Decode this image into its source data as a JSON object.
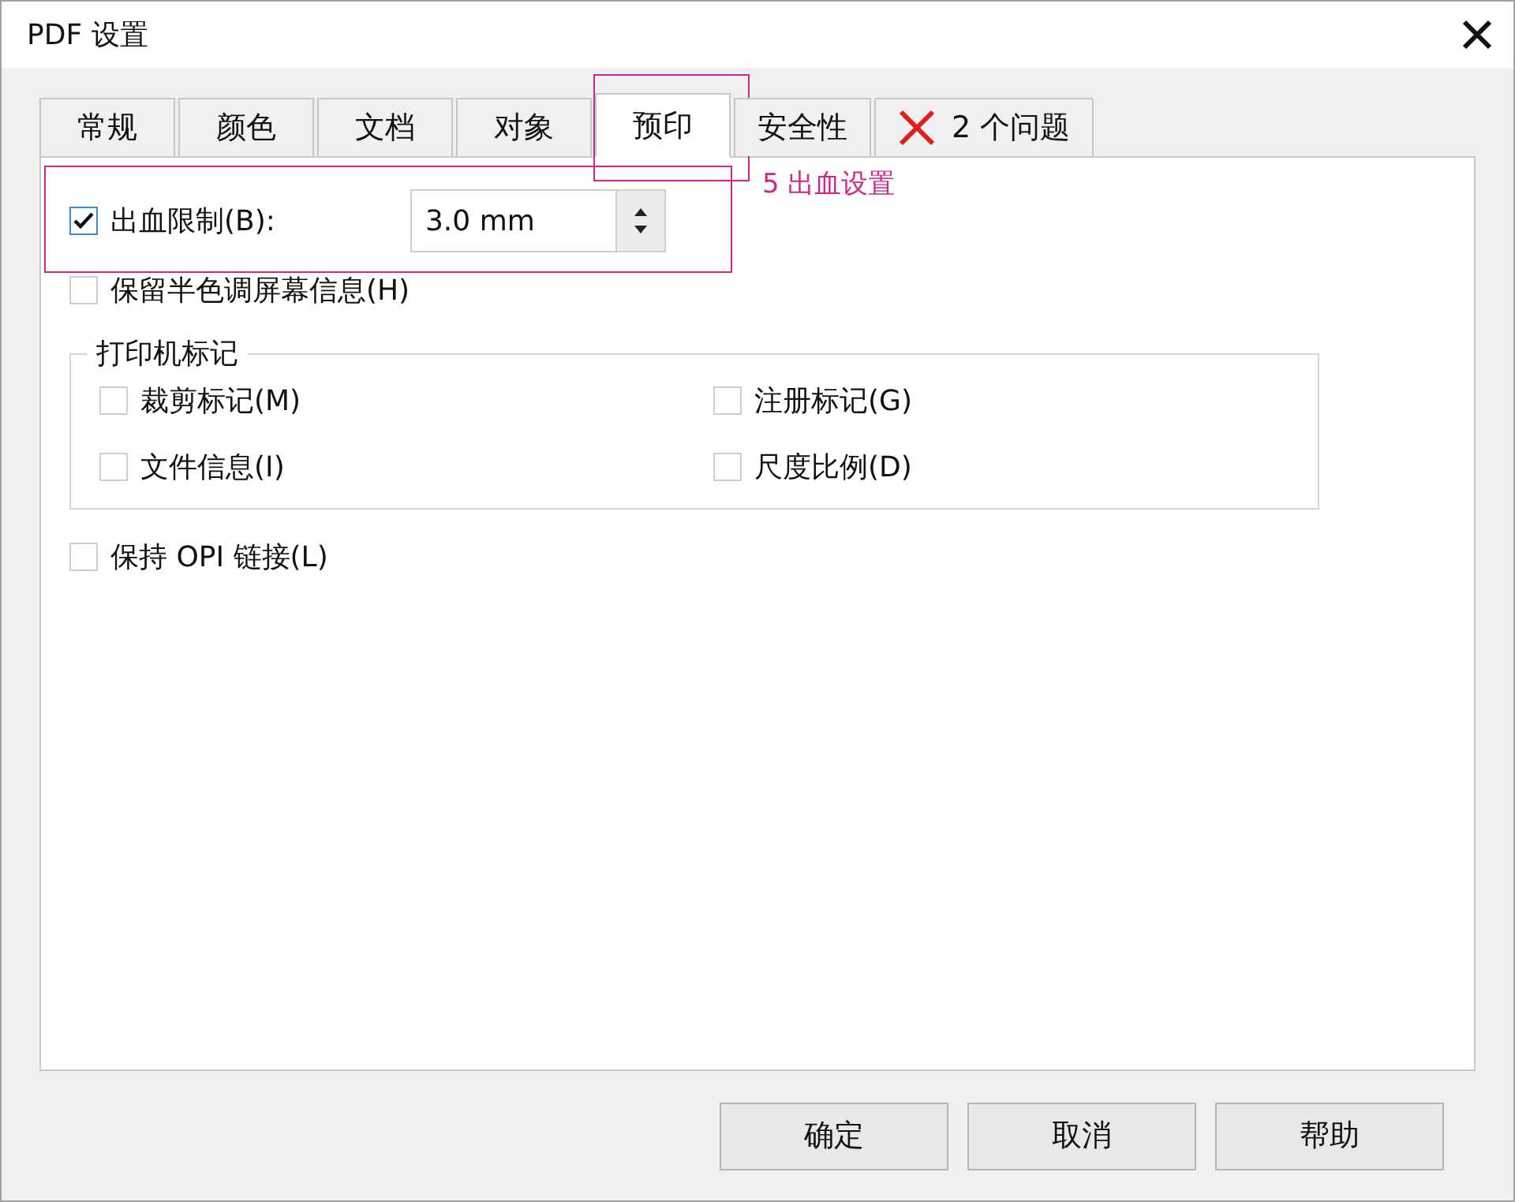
{
  "window": {
    "title": "PDF 设置"
  },
  "tabs": [
    {
      "label": "常规",
      "selected": false,
      "kind": "text"
    },
    {
      "label": "颜色",
      "selected": false,
      "kind": "text"
    },
    {
      "label": "文档",
      "selected": false,
      "kind": "text"
    },
    {
      "label": "对象",
      "selected": false,
      "kind": "text"
    },
    {
      "label": "预印",
      "selected": true,
      "kind": "text"
    },
    {
      "label": "安全性",
      "selected": false,
      "kind": "text"
    },
    {
      "label": "2 个问题",
      "selected": false,
      "kind": "issues"
    }
  ],
  "bleed": {
    "label": "出血限制(B):",
    "checked": true,
    "value": "3.0 mm"
  },
  "halftone": {
    "label": "保留半色调屏幕信息(H)",
    "checked": false
  },
  "printer_marks": {
    "title": "打印机标记",
    "items": [
      {
        "label": "裁剪标记(M)",
        "checked": false
      },
      {
        "label": "注册标记(G)",
        "checked": false
      },
      {
        "label": "文件信息(I)",
        "checked": false
      },
      {
        "label": "尺度比例(D)",
        "checked": false
      }
    ]
  },
  "opi": {
    "label": "保持 OPI 链接(L)",
    "checked": false
  },
  "annotation": {
    "label": "5 出血设置"
  },
  "buttons": [
    "确定",
    "取消",
    "帮助"
  ]
}
